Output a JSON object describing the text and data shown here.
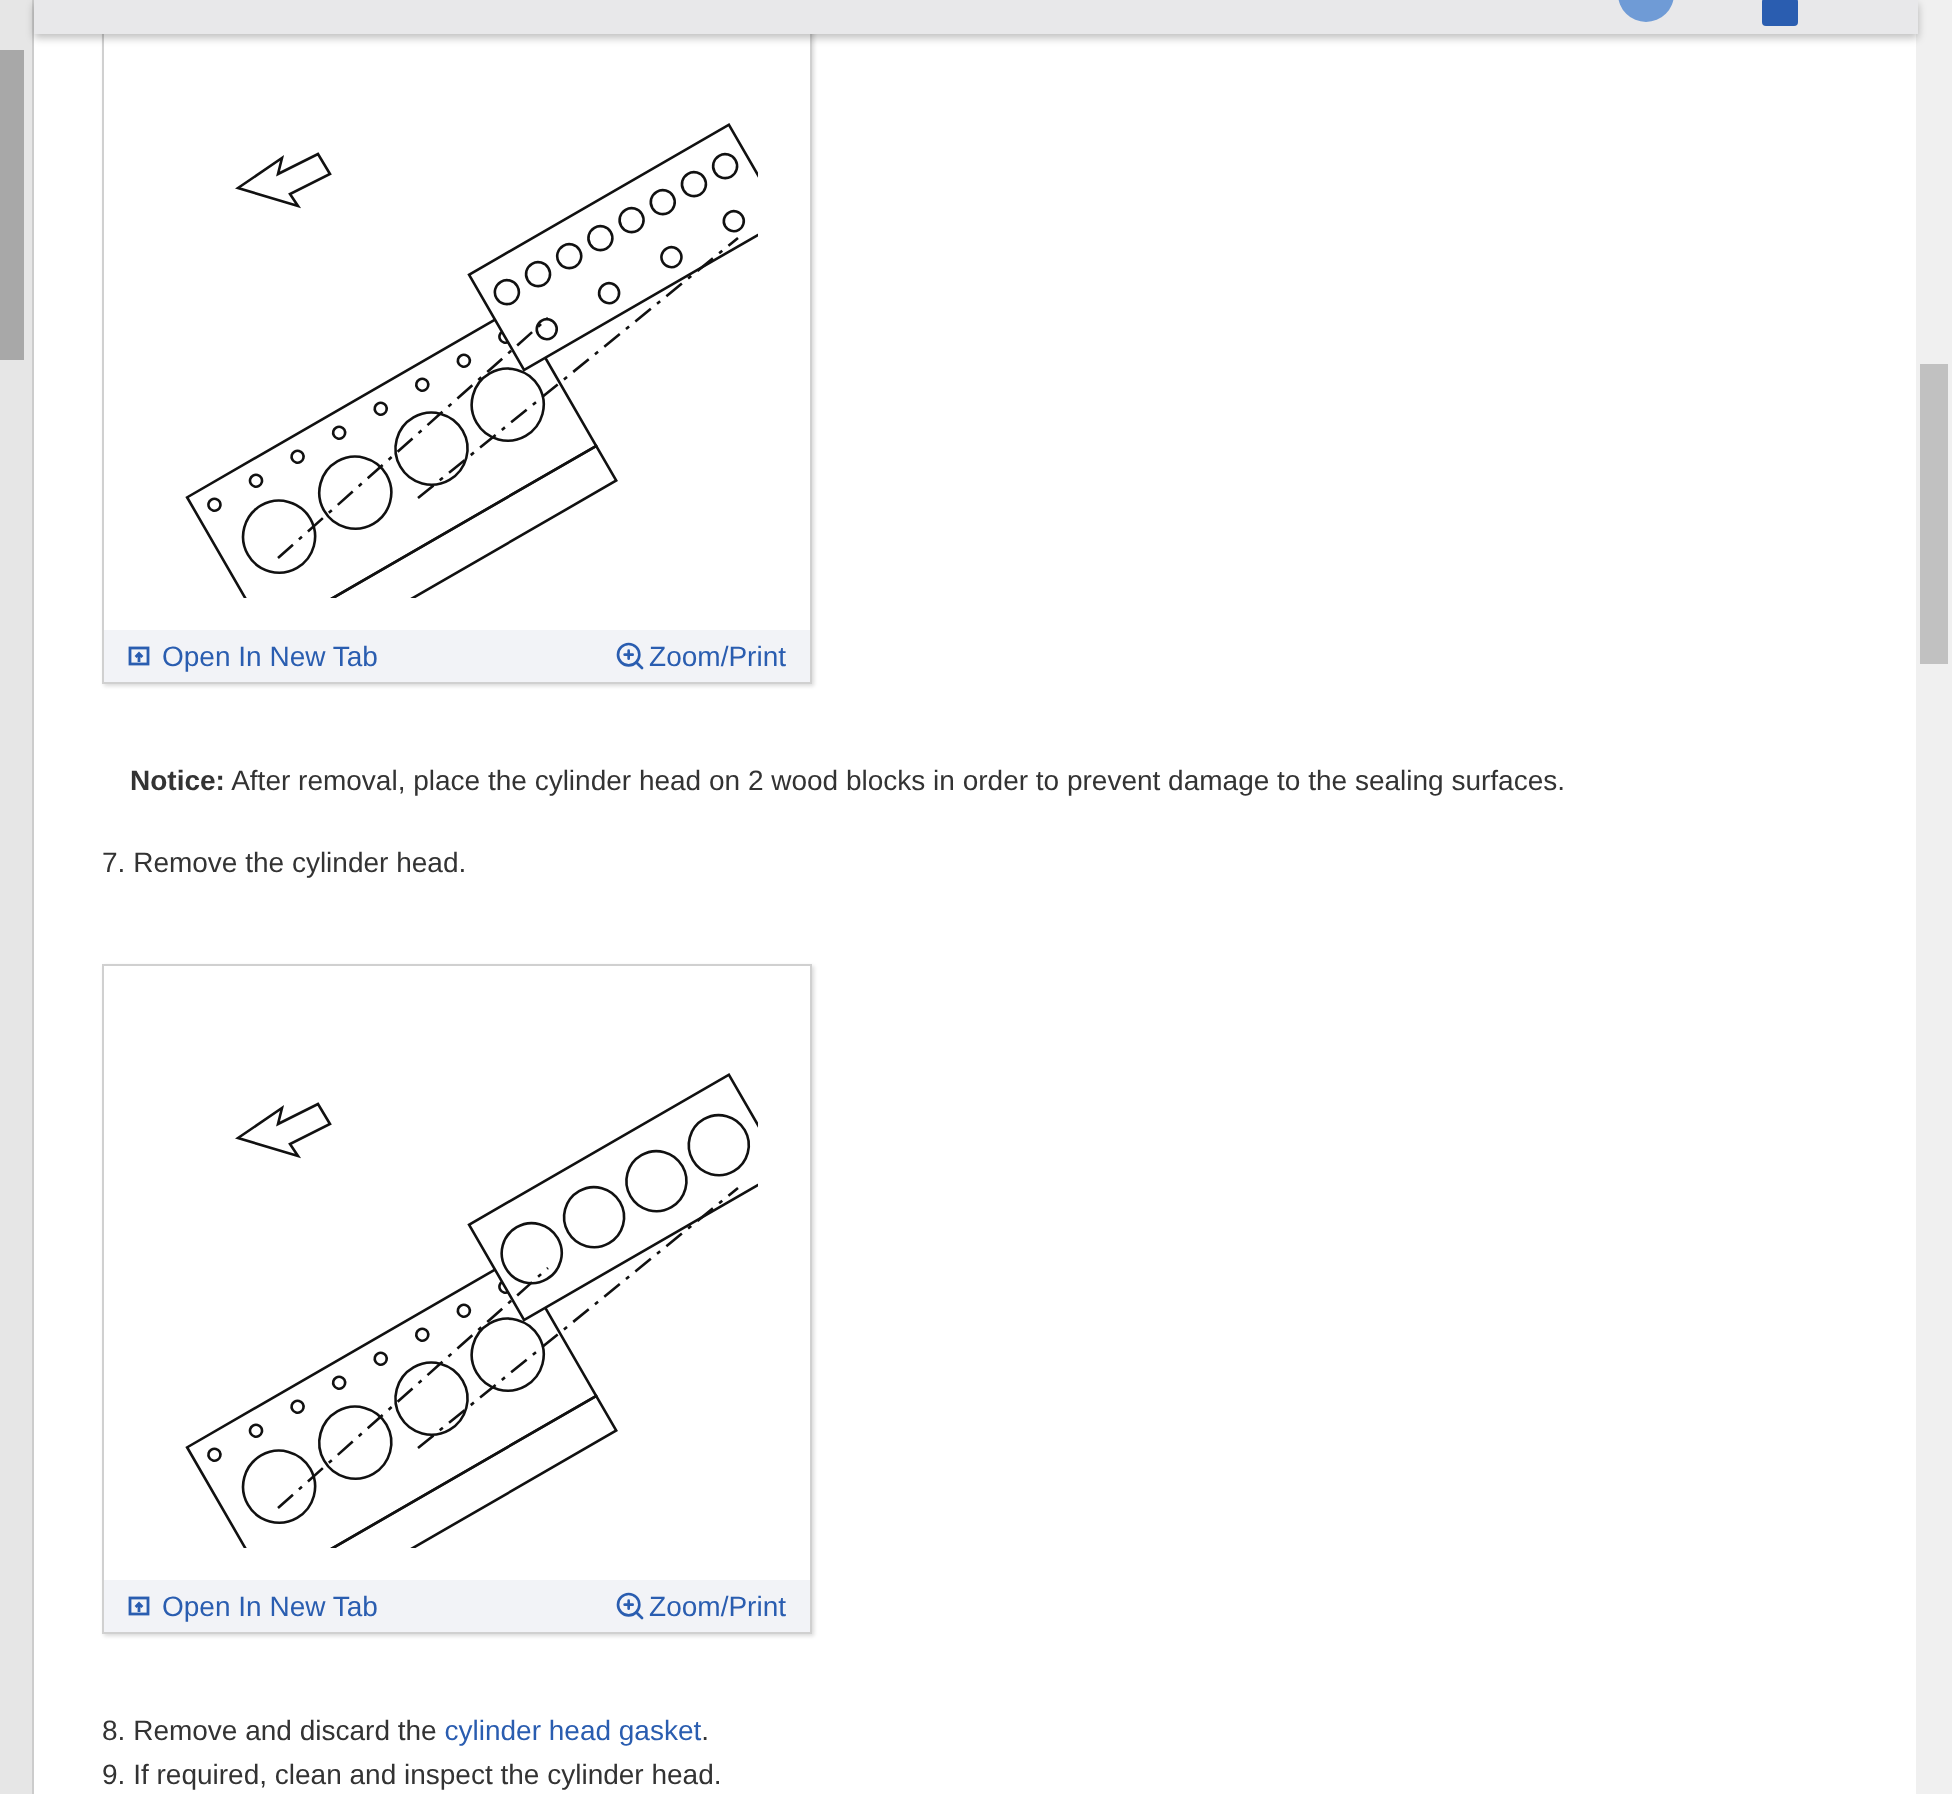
{
  "blocks": [
    {
      "kind": "figure",
      "open_label": "Open In New Tab",
      "zoom_label": "Zoom/Print"
    },
    {
      "kind": "notice",
      "label": "Notice:",
      "text": "After removal, place the cylinder head on 2 wood blocks in order to prevent damage to the sealing surfaces."
    },
    {
      "kind": "step",
      "number": "7.",
      "text": "Remove the cylinder head."
    },
    {
      "kind": "figure",
      "open_label": "Open In New Tab",
      "zoom_label": "Zoom/Print"
    },
    {
      "kind": "step",
      "number": "8.",
      "text": "Remove and discard the",
      "link": "cylinder head gasket",
      "after": "."
    },
    {
      "kind": "step",
      "number": "9.",
      "text": "If required, clean and inspect the cylinder head."
    }
  ]
}
